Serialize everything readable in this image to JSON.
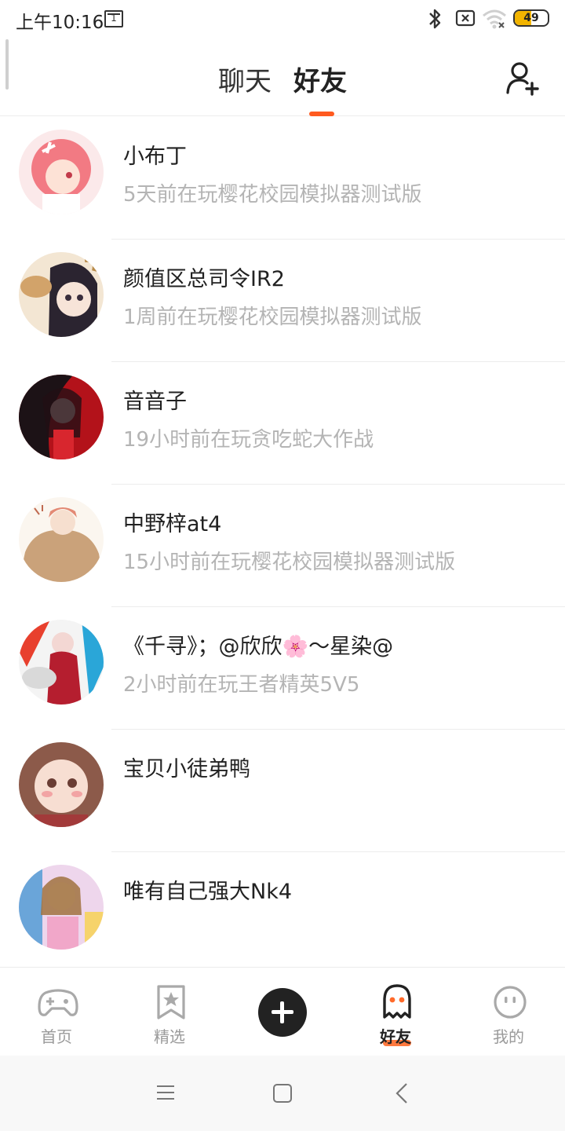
{
  "status_bar": {
    "time": "上午10:16",
    "calendar_day": "1",
    "battery_level": "49",
    "battery_percent": 49,
    "icons": [
      "calendar-icon",
      "bluetooth-icon",
      "no-sim-icon",
      "wifi-icon",
      "battery-icon"
    ]
  },
  "header": {
    "tabs": [
      {
        "label": "聊天",
        "active": false
      },
      {
        "label": "好友",
        "active": true
      }
    ],
    "add_friend_icon": "add-user-icon",
    "accent_color": "#ff5a1f"
  },
  "friends": [
    {
      "name": "小布丁",
      "status": "5天前在玩樱花校园模拟器测试版"
    },
    {
      "name": "颜值区总司令IR2",
      "status": "1周前在玩樱花校园模拟器测试版"
    },
    {
      "name": "音音子",
      "status": "19小时前在玩贪吃蛇大作战"
    },
    {
      "name": "中野梓at4",
      "status": "15小时前在玩樱花校园模拟器测试版"
    },
    {
      "name": "《千寻》；@欣欣🌸～星染@",
      "status": "2小时前在玩王者精英5V5"
    },
    {
      "name": "宝贝小徒弟鸭",
      "status": ""
    },
    {
      "name": "唯有自己强大Nk4",
      "status": ""
    }
  ],
  "bottom_nav": {
    "items": [
      {
        "label": "首页",
        "icon": "gamepad-icon",
        "active": false
      },
      {
        "label": "精选",
        "icon": "star-bookmark-icon",
        "active": false
      },
      {
        "label": "",
        "icon": "plus-icon",
        "active": false
      },
      {
        "label": "好友",
        "icon": "ghost-icon",
        "active": true
      },
      {
        "label": "我的",
        "icon": "face-icon",
        "active": false
      }
    ]
  },
  "system_nav": {
    "icons": [
      "menu-icon",
      "home-icon",
      "back-icon"
    ]
  }
}
